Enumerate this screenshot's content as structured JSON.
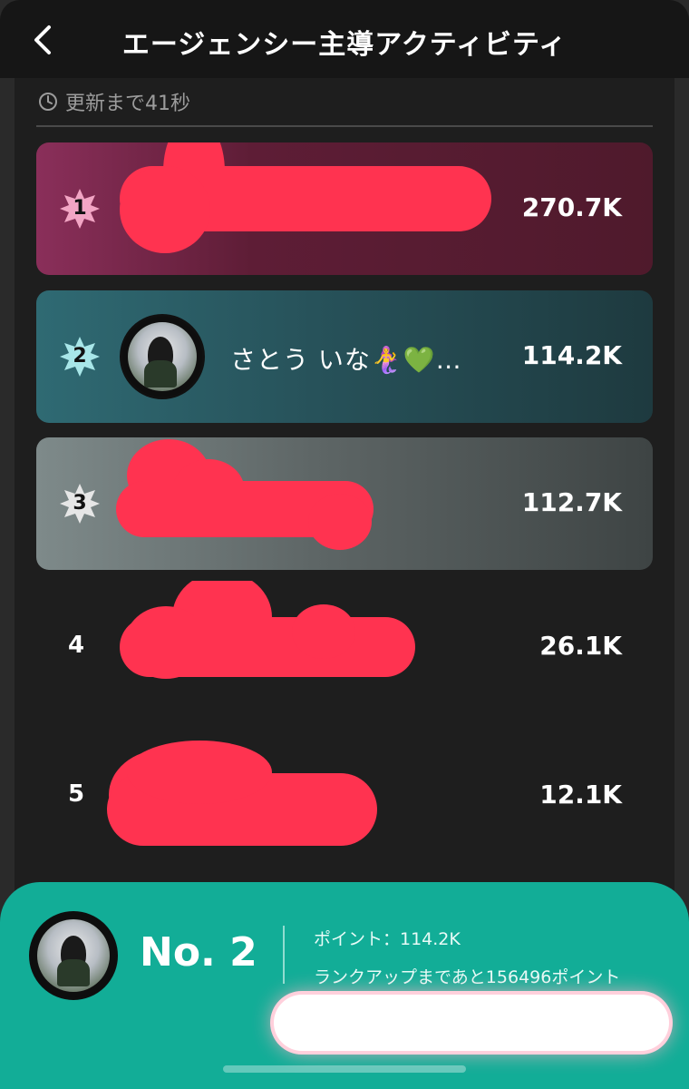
{
  "header": {
    "title": "エージェンシー主導アクティビティ",
    "back_icon": "chevron-left-icon"
  },
  "timer": {
    "text": "更新まで41秒",
    "icon": "clock-icon"
  },
  "ranking": [
    {
      "rank": "1",
      "name": "",
      "points": "270.7K",
      "badge_color": "#f2a5c4"
    },
    {
      "rank": "2",
      "name": "さとう いな🧜‍♀️💚…",
      "points": "114.2K",
      "badge_color": "#a8e6e8"
    },
    {
      "rank": "3",
      "name": "",
      "points": "112.7K",
      "badge_color": "#e6e6e6"
    },
    {
      "rank": "4",
      "name": "",
      "points": "26.1K"
    },
    {
      "rank": "5",
      "name": "",
      "points": "12.1K"
    }
  ],
  "footer": {
    "rank_label": "No. 2",
    "points_line": "ポイント：114.2K",
    "rankup_line": "ランクアップまであと156496ポイント"
  },
  "colors": {
    "accent": "#12ad97",
    "redaction": "#ff3350"
  }
}
